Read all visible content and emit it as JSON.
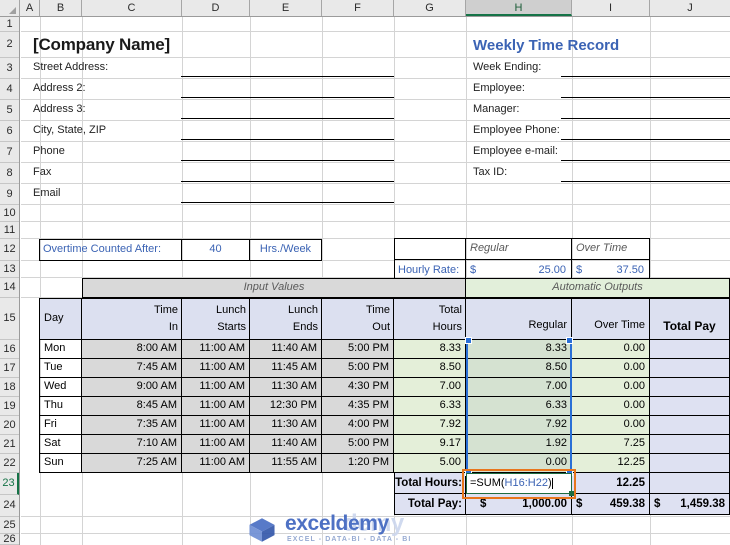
{
  "app": "excel-worksheet",
  "columns": [
    "A",
    "B",
    "C",
    "D",
    "E",
    "F",
    "G",
    "H",
    "I",
    "J"
  ],
  "active_column": "H",
  "active_row": "23",
  "rows": [
    "1",
    "2",
    "3",
    "4",
    "5",
    "6",
    "7",
    "8",
    "9",
    "10",
    "11",
    "12",
    "13",
    "14",
    "15",
    "16",
    "17",
    "18",
    "19",
    "20",
    "21",
    "22",
    "23",
    "24",
    "25",
    "26"
  ],
  "company": {
    "title": "[Company Name]",
    "fields": [
      {
        "label": "Street Address:"
      },
      {
        "label": "Address 2:"
      },
      {
        "label": "Address 3:"
      },
      {
        "label": "City, State, ZIP"
      },
      {
        "label": "Phone"
      },
      {
        "label": "Fax"
      },
      {
        "label": "Email"
      }
    ]
  },
  "record": {
    "title": "Weekly Time Record",
    "fields": [
      {
        "label": "Week Ending:"
      },
      {
        "label": "Employee:"
      },
      {
        "label": "Manager:"
      },
      {
        "label": "Employee Phone:"
      },
      {
        "label": "Employee e-mail:"
      },
      {
        "label": "Tax ID:"
      }
    ]
  },
  "overtime": {
    "label": "Overtime Counted After:",
    "value": "40",
    "unit": "Hrs./Week"
  },
  "hourly_rate": {
    "label": "Hourly Rate:",
    "col_regular": "Regular",
    "col_overtime": "Over Time",
    "currency": "$",
    "regular": "25.00",
    "overtime": "37.50"
  },
  "table": {
    "band_input": "Input Values",
    "band_output": "Automatic Outputs",
    "headers": {
      "day": "Day",
      "time_in_1": "Time",
      "time_in_2": "In",
      "lunch_start_1": "Lunch",
      "lunch_start_2": "Starts",
      "lunch_end_1": "Lunch",
      "lunch_end_2": "Ends",
      "time_out_1": "Time",
      "time_out_2": "Out",
      "total_hours_1": "Total",
      "total_hours_2": "Hours",
      "regular": "Regular",
      "overtime": "Over Time",
      "total_pay": "Total Pay"
    },
    "rows": [
      {
        "day": "Mon",
        "time_in": "8:00 AM",
        "lunch_start": "11:00 AM",
        "lunch_end": "11:40 AM",
        "time_out": "5:00 PM",
        "total_hours": "8.33",
        "regular": "8.33",
        "overtime": "0.00",
        "total_pay": ""
      },
      {
        "day": "Tue",
        "time_in": "7:45 AM",
        "lunch_start": "11:00 AM",
        "lunch_end": "11:45 AM",
        "time_out": "5:00 PM",
        "total_hours": "8.50",
        "regular": "8.50",
        "overtime": "0.00",
        "total_pay": ""
      },
      {
        "day": "Wed",
        "time_in": "9:00 AM",
        "lunch_start": "11:00 AM",
        "lunch_end": "11:30 AM",
        "time_out": "4:30 PM",
        "total_hours": "7.00",
        "regular": "7.00",
        "overtime": "0.00",
        "total_pay": ""
      },
      {
        "day": "Thu",
        "time_in": "8:45 AM",
        "lunch_start": "11:00 AM",
        "lunch_end": "12:30 PM",
        "time_out": "4:35 PM",
        "total_hours": "6.33",
        "regular": "6.33",
        "overtime": "0.00",
        "total_pay": ""
      },
      {
        "day": "Fri",
        "time_in": "7:35 AM",
        "lunch_start": "11:00 AM",
        "lunch_end": "11:30 AM",
        "time_out": "4:00 PM",
        "total_hours": "7.92",
        "regular": "7.92",
        "overtime": "0.00",
        "total_pay": ""
      },
      {
        "day": "Sat",
        "time_in": "7:10 AM",
        "lunch_start": "11:00 AM",
        "lunch_end": "11:40 AM",
        "time_out": "5:00 PM",
        "total_hours": "9.17",
        "regular": "1.92",
        "overtime": "7.25",
        "total_pay": ""
      },
      {
        "day": "Sun",
        "time_in": "7:25 AM",
        "lunch_start": "11:00 AM",
        "lunch_end": "11:55 AM",
        "time_out": "1:20 PM",
        "total_hours": "5.00",
        "regular": "0.00",
        "overtime": "12.25",
        "total_pay": ""
      }
    ],
    "total_hours_label": "Total Hours:",
    "total_hours_regular_formula": "=SUM(",
    "total_hours_formula_ref": "H16:H22",
    "total_hours_formula_close": ")",
    "total_hours_overtime": "12.25",
    "total_pay_label": "Total Pay:",
    "total_pay_currency": "$",
    "total_pay_regular": "1,000.00",
    "total_pay_overtime": "459.38",
    "total_pay_total": "1,459.38"
  },
  "watermark": {
    "main": "exceldemy",
    "ghost": "demy",
    "sub": "EXCEL - DATA-BI - DATA - BI"
  },
  "colors": {
    "accent_blue": "#3b63b4",
    "header_lavender": "#dce0f0",
    "input_gray": "#d9d9d9",
    "output_green": "#e4efd9",
    "selection_blue": "#2a6fd6",
    "edit_orange": "#e8761c",
    "edit_green": "#1e6c41"
  }
}
